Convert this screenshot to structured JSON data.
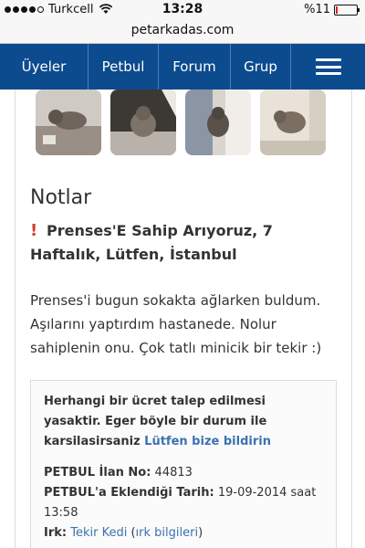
{
  "status_bar": {
    "carrier": "Turkcell",
    "time": "13:28",
    "battery_text": "%11",
    "battery_level_percent": 11
  },
  "browser": {
    "url": "petarkadas.com"
  },
  "nav": {
    "items": [
      "Üyeler",
      "Petbul",
      "Forum",
      "Grup"
    ],
    "menu_icon": "hamburger-menu-icon"
  },
  "content": {
    "notes_heading": "Notlar",
    "listing_title": "Prenses'E Sahip Arıyoruz, 7 Haftalık, Lütfen, İstanbul",
    "description": "Prenses'i bugun sokakta ağlarken buldum. Aşılarını yaptırdım hastanede. Nolur sahiplenin onu. Çok tatlı minicik bir tekir :)",
    "notice": {
      "text": "Herhangi bir ücret talep edilmesi yasaktir. Eger böyle bir durum ile karsilasirsaniz ",
      "link": "Lütfen bize bildirin"
    },
    "meta": {
      "ilan_label": "PETBUL İlan No:",
      "ilan_value": "44813",
      "date_label": "PETBUL'a Eklendiği Tarih:",
      "date_value": "19-09-2014 saat 13:58",
      "irk_label": "Irk:",
      "irk_value": "Tekir Kedi",
      "irk_info_link": "ırk bilgileri"
    }
  },
  "colors": {
    "nav_background": "#0c4b8e",
    "link": "#3b72b0",
    "alert_red": "#d23d2c"
  }
}
